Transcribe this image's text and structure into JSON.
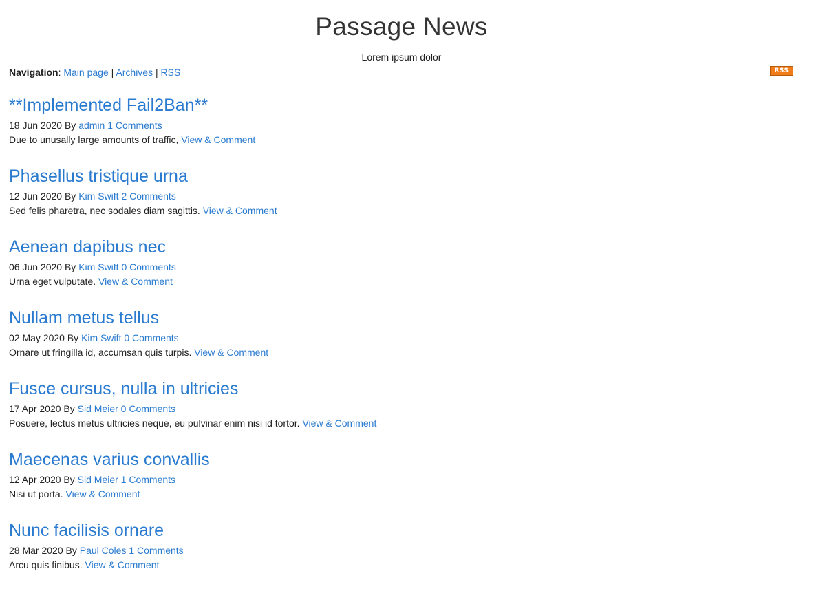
{
  "site": {
    "title": "Passage News",
    "tagline": "Lorem ipsum dolor"
  },
  "nav": {
    "label": "Navigation",
    "colon": ":",
    "separator": "|",
    "items": [
      {
        "label": "Main page"
      },
      {
        "label": "Archives"
      },
      {
        "label": "RSS"
      }
    ],
    "rss_badge": "RSS",
    "rss_badge_color": "#f07d1a"
  },
  "colors": {
    "link": "#2a7bd0",
    "text": "#222222"
  },
  "posts": [
    {
      "title": "**Implemented Fail2Ban**",
      "date": "18 Jun 2020",
      "by": "By",
      "author": "admin",
      "comments": "1 Comments",
      "excerpt": "Due to unusally large amounts of traffic,",
      "link": "View & Comment"
    },
    {
      "title": "Phasellus tristique urna",
      "date": "12 Jun 2020",
      "by": "By",
      "author": "Kim Swift",
      "comments": "2 Comments",
      "excerpt": "Sed felis pharetra, nec sodales diam sagittis.",
      "link": "View & Comment"
    },
    {
      "title": "Aenean dapibus nec",
      "date": "06 Jun 2020",
      "by": "By",
      "author": "Kim Swift",
      "comments": "0 Comments",
      "excerpt": "Urna eget vulputate.",
      "link": "View & Comment"
    },
    {
      "title": "Nullam metus tellus",
      "date": "02 May 2020",
      "by": "By",
      "author": "Kim Swift",
      "comments": "0 Comments",
      "excerpt": "Ornare ut fringilla id, accumsan quis turpis.",
      "link": "View & Comment"
    },
    {
      "title": "Fusce cursus, nulla in ultricies",
      "date": "17 Apr 2020",
      "by": "By",
      "author": "Sid Meier",
      "comments": "0 Comments",
      "excerpt": "Posuere, lectus metus ultricies neque, eu pulvinar enim nisi id tortor.",
      "link": "View & Comment"
    },
    {
      "title": "Maecenas varius convallis",
      "date": "12 Apr 2020",
      "by": "By",
      "author": "Sid Meier",
      "comments": "1 Comments",
      "excerpt": "Nisi ut porta.",
      "link": "View & Comment"
    },
    {
      "title": "Nunc facilisis ornare",
      "date": "28 Mar 2020",
      "by": "By",
      "author": "Paul Coles",
      "comments": "1 Comments",
      "excerpt": "Arcu quis finibus.",
      "link": "View & Comment"
    }
  ]
}
